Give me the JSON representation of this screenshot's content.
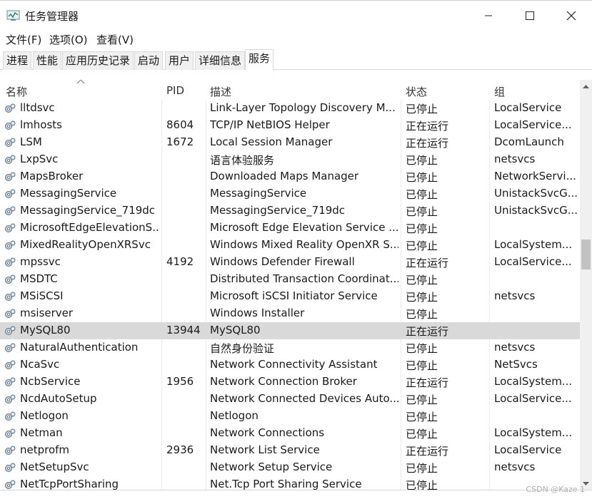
{
  "window": {
    "title": "任务管理器",
    "controls": {
      "minimize": "minimize-icon",
      "maximize": "maximize-icon",
      "close": "close-icon"
    }
  },
  "menu": [
    {
      "label": "文件(F)"
    },
    {
      "label": "选项(O)"
    },
    {
      "label": "查看(V)"
    }
  ],
  "tabs": [
    {
      "label": "进程"
    },
    {
      "label": "性能"
    },
    {
      "label": "应用历史记录"
    },
    {
      "label": "启动"
    },
    {
      "label": "用户"
    },
    {
      "label": "详细信息"
    },
    {
      "label": "服务",
      "active": true
    }
  ],
  "columns": {
    "name": "名称",
    "pid": "PID",
    "description": "描述",
    "status": "状态",
    "group": "组"
  },
  "rows": [
    {
      "name": "lltdsvc",
      "pid": "",
      "description": "Link-Layer Topology Discovery M...",
      "status": "已停止",
      "group": "LocalService"
    },
    {
      "name": "lmhosts",
      "pid": "8604",
      "description": "TCP/IP NetBIOS Helper",
      "status": "正在运行",
      "group": "LocalService..."
    },
    {
      "name": "LSM",
      "pid": "1672",
      "description": "Local Session Manager",
      "status": "正在运行",
      "group": "DcomLaunch"
    },
    {
      "name": "LxpSvc",
      "pid": "",
      "description": "语言体验服务",
      "status": "已停止",
      "group": "netsvcs"
    },
    {
      "name": "MapsBroker",
      "pid": "",
      "description": "Downloaded Maps Manager",
      "status": "已停止",
      "group": "NetworkServi..."
    },
    {
      "name": "MessagingService",
      "pid": "",
      "description": "MessagingService",
      "status": "已停止",
      "group": "UnistackSvcG..."
    },
    {
      "name": "MessagingService_719dc",
      "pid": "",
      "description": "MessagingService_719dc",
      "status": "已停止",
      "group": "UnistackSvcG..."
    },
    {
      "name": "MicrosoftEdgeElevationS...",
      "pid": "",
      "description": "Microsoft Edge Elevation Service ...",
      "status": "已停止",
      "group": ""
    },
    {
      "name": "MixedRealityOpenXRSvc",
      "pid": "",
      "description": "Windows Mixed Reality OpenXR S...",
      "status": "已停止",
      "group": "LocalSystem..."
    },
    {
      "name": "mpssvc",
      "pid": "4192",
      "description": "Windows Defender Firewall",
      "status": "正在运行",
      "group": "LocalService..."
    },
    {
      "name": "MSDTC",
      "pid": "",
      "description": "Distributed Transaction Coordinat...",
      "status": "已停止",
      "group": ""
    },
    {
      "name": "MSiSCSI",
      "pid": "",
      "description": "Microsoft iSCSI Initiator Service",
      "status": "已停止",
      "group": "netsvcs"
    },
    {
      "name": "msiserver",
      "pid": "",
      "description": "Windows Installer",
      "status": "已停止",
      "group": ""
    },
    {
      "name": "MySQL80",
      "pid": "13944",
      "description": "MySQL80",
      "status": "正在运行",
      "group": "",
      "selected": true
    },
    {
      "name": "NaturalAuthentication",
      "pid": "",
      "description": "自然身份验证",
      "status": "已停止",
      "group": "netsvcs"
    },
    {
      "name": "NcaSvc",
      "pid": "",
      "description": "Network Connectivity Assistant",
      "status": "已停止",
      "group": "NetSvcs"
    },
    {
      "name": "NcbService",
      "pid": "1956",
      "description": "Network Connection Broker",
      "status": "正在运行",
      "group": "LocalSystem..."
    },
    {
      "name": "NcdAutoSetup",
      "pid": "",
      "description": "Network Connected Devices Auto...",
      "status": "已停止",
      "group": "LocalService..."
    },
    {
      "name": "Netlogon",
      "pid": "",
      "description": "Netlogon",
      "status": "已停止",
      "group": ""
    },
    {
      "name": "Netman",
      "pid": "",
      "description": "Network Connections",
      "status": "已停止",
      "group": "LocalSystem..."
    },
    {
      "name": "netprofm",
      "pid": "2936",
      "description": "Network List Service",
      "status": "正在运行",
      "group": "LocalService"
    },
    {
      "name": "NetSetupSvc",
      "pid": "",
      "description": "Network Setup Service",
      "status": "已停止",
      "group": "netsvcs"
    },
    {
      "name": "NetTcpPortSharing",
      "pid": "",
      "description": "Net.Tcp Port Sharing Service",
      "status": "已停止",
      "group": ""
    }
  ],
  "icons": {
    "service_row": "gear-icon",
    "app": "task-manager-icon",
    "sort": "sort-up-icon"
  },
  "watermark": "CSDN @Kaze 1"
}
